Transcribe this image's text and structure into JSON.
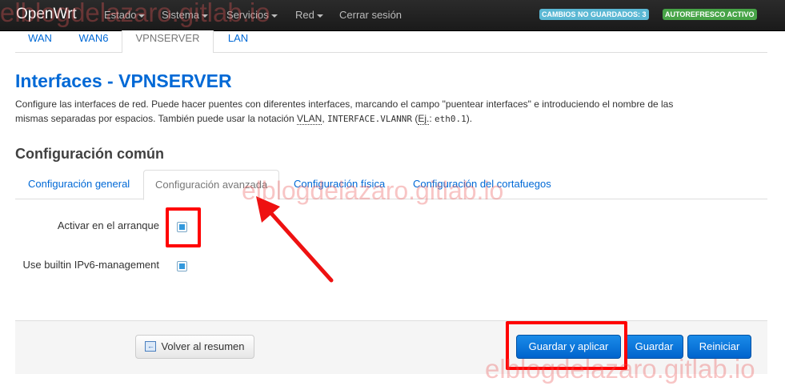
{
  "navbar": {
    "brand": "OpenWrt",
    "menu": [
      {
        "label": "Estado",
        "dropdown": true
      },
      {
        "label": "Sistema",
        "dropdown": true
      },
      {
        "label": "Servicios",
        "dropdown": true
      },
      {
        "label": "Red",
        "dropdown": true
      },
      {
        "label": "Cerrar sesión",
        "dropdown": false
      }
    ],
    "badges": {
      "unsaved": "CAMBIOS NO GUARDADOS: 3",
      "autorefresh": "AUTOREFRESCO ACTIVO"
    }
  },
  "interface_tabs": [
    {
      "label": "WAN",
      "active": false
    },
    {
      "label": "WAN6",
      "active": false
    },
    {
      "label": "VPNSERVER",
      "active": true
    },
    {
      "label": "LAN",
      "active": false
    }
  ],
  "page": {
    "title": "Interfaces - VPNSERVER",
    "description_line1": "Configure las interfaces de red. Puede hacer puentes con diferentes interfaces, marcando el campo \"puentear interfaces\" e introduciendo el nombre de las",
    "description_line2_prefix": "mismas separadas por espacios. También puede usar la notación ",
    "description_vlan": "VLAN",
    "description_sep1": ", ",
    "description_code1": "INTERFACE.VLANNR",
    "description_sep2": " (",
    "description_example": "Ej.",
    "description_sep3": ": ",
    "description_code2": "eth0.1",
    "description_end": ")."
  },
  "section": {
    "title": "Configuración común",
    "tabs": [
      {
        "label": "Configuración general",
        "active": false
      },
      {
        "label": "Configuración avanzada",
        "active": true
      },
      {
        "label": "Configuración física",
        "active": false
      },
      {
        "label": "Configuración del cortafuegos",
        "active": false
      }
    ]
  },
  "fields": {
    "bringup": {
      "label": "Activar en el arranque",
      "checked": true
    },
    "ipv6_management": {
      "label": "Use builtin IPv6-management",
      "checked": true
    }
  },
  "actions": {
    "back": "Volver al resumen",
    "save_apply": "Guardar y aplicar",
    "save": "Guardar",
    "reset": "Reiniciar"
  },
  "annotations": {
    "watermark": "elblogdelazaro.gitlab.io",
    "highlight_color": "#ff0000"
  },
  "colors": {
    "link": "#0069d6",
    "navbar_bg": "#222222",
    "badge_unsaved": "#5bb8d4",
    "badge_refresh": "#47a447",
    "primary_button": "#0064cd"
  }
}
